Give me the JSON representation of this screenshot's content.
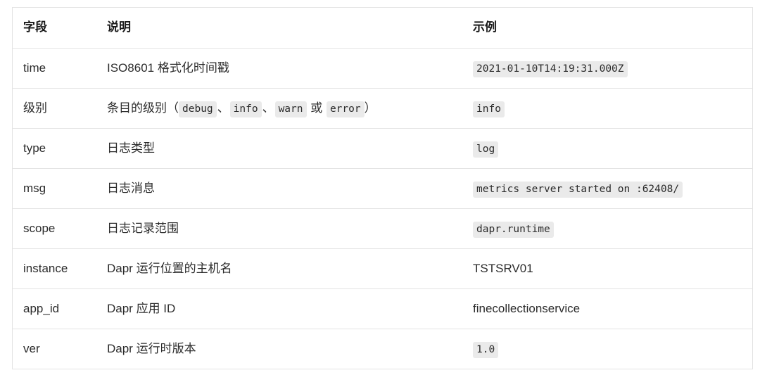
{
  "table": {
    "columns": [
      {
        "key": "field",
        "label": "字段"
      },
      {
        "key": "desc",
        "label": "说明"
      },
      {
        "key": "example",
        "label": "示例"
      }
    ],
    "rows": [
      {
        "field": "time",
        "desc_plain": "ISO8601 格式化时间戳",
        "example": "2021-01-10T14:19:31.000Z",
        "example_style": "code"
      },
      {
        "field": "级别",
        "desc_prefix": "条目的级别（",
        "desc_codes": [
          "debug",
          "info",
          "warn",
          "error"
        ],
        "desc_sep_1": "、",
        "desc_sep_2": "、",
        "desc_sep_3": " 或 ",
        "desc_suffix": "）",
        "example": "info",
        "example_style": "code"
      },
      {
        "field": "type",
        "desc_plain": "日志类型",
        "example": "log",
        "example_style": "code"
      },
      {
        "field": "msg",
        "desc_plain": "日志消息",
        "example": "metrics server started on :62408/",
        "example_style": "code"
      },
      {
        "field": "scope",
        "desc_plain": "日志记录范围",
        "example": "dapr.runtime",
        "example_style": "code"
      },
      {
        "field": "instance",
        "desc_plain": "Dapr 运行位置的主机名",
        "example": "TSTSRV01",
        "example_style": "plain"
      },
      {
        "field": "app_id",
        "desc_plain": "Dapr 应用 ID",
        "example": "finecollectionservice",
        "example_style": "plain"
      },
      {
        "field": "ver",
        "desc_plain": "Dapr 运行时版本",
        "example": "1.0",
        "example_style": "code"
      }
    ]
  },
  "colors": {
    "code_background": "#eaeaea",
    "border": "#e4e4e4",
    "text": "#2c2c2c",
    "header_text": "#1a1a1a",
    "page_background": "#ffffff"
  }
}
